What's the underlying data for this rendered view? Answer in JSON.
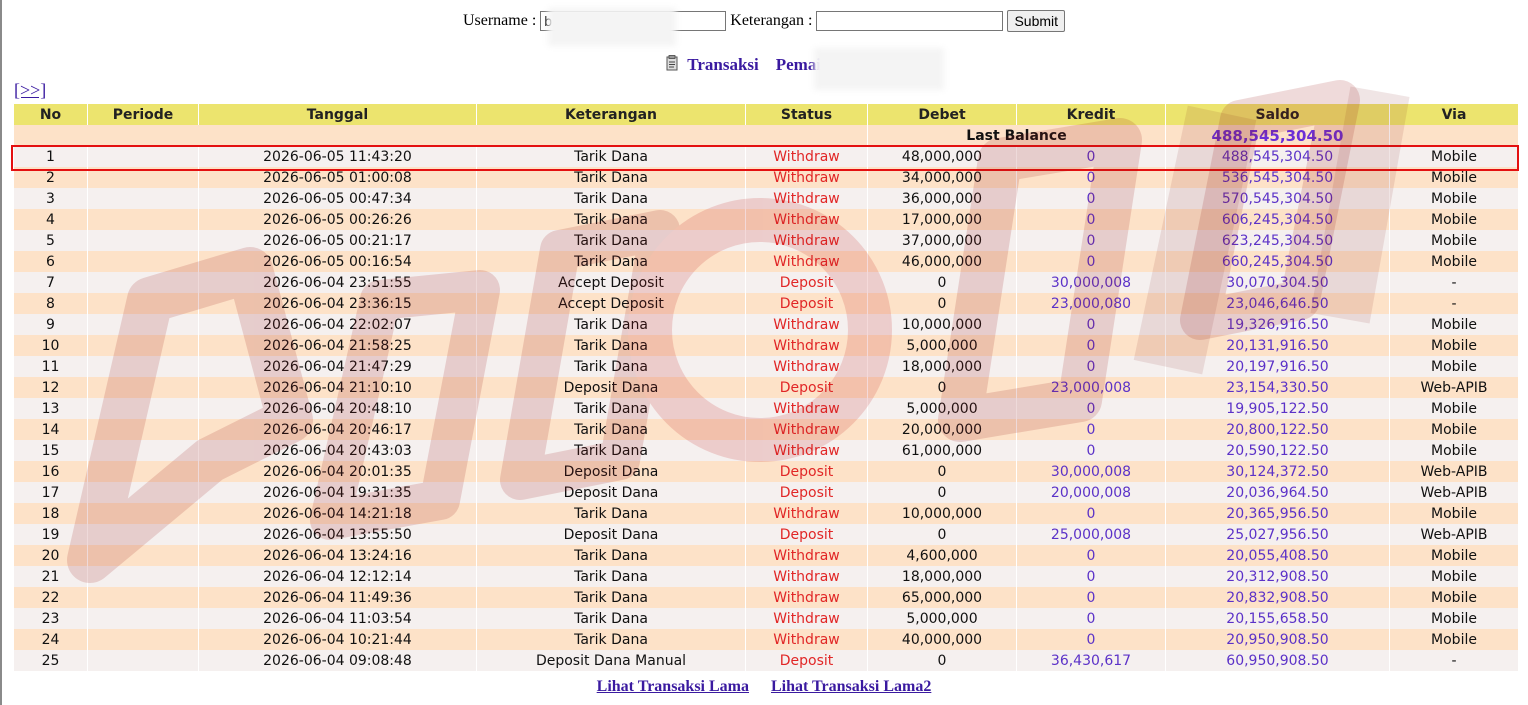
{
  "form": {
    "username_label": "Username :",
    "username_value": "b",
    "keterangan_label": "Keterangan :",
    "keterangan_value": "",
    "submit_label": "Submit"
  },
  "heading": {
    "transaksi_label": "Transaksi",
    "pemain_label": "Pemain :",
    "pemain_value": "be",
    "icon": "document-icon"
  },
  "pager": {
    "next_label": "[>>]"
  },
  "table": {
    "columns": [
      "No",
      "Periode",
      "Tanggal",
      "Keterangan",
      "Status",
      "Debet",
      "Kredit",
      "Saldo",
      "Via"
    ],
    "last_balance_label": "Last Balance",
    "last_balance_value": "488,545,304.50",
    "rows": [
      {
        "no": "1",
        "periode": "",
        "tanggal": "2026-06-05 11:43:20",
        "keterangan": "Tarik Dana",
        "status": "Withdraw",
        "debet": "48,000,000",
        "kredit": "0",
        "saldo": "488,545,304.50",
        "via": "Mobile"
      },
      {
        "no": "2",
        "periode": "",
        "tanggal": "2026-06-05 01:00:08",
        "keterangan": "Tarik Dana",
        "status": "Withdraw",
        "debet": "34,000,000",
        "kredit": "0",
        "saldo": "536,545,304.50",
        "via": "Mobile"
      },
      {
        "no": "3",
        "periode": "",
        "tanggal": "2026-06-05 00:47:34",
        "keterangan": "Tarik Dana",
        "status": "Withdraw",
        "debet": "36,000,000",
        "kredit": "0",
        "saldo": "570,545,304.50",
        "via": "Mobile"
      },
      {
        "no": "4",
        "periode": "",
        "tanggal": "2026-06-05 00:26:26",
        "keterangan": "Tarik Dana",
        "status": "Withdraw",
        "debet": "17,000,000",
        "kredit": "0",
        "saldo": "606,245,304.50",
        "via": "Mobile"
      },
      {
        "no": "5",
        "periode": "",
        "tanggal": "2026-06-05 00:21:17",
        "keterangan": "Tarik Dana",
        "status": "Withdraw",
        "debet": "37,000,000",
        "kredit": "0",
        "saldo": "623,245,304.50",
        "via": "Mobile"
      },
      {
        "no": "6",
        "periode": "",
        "tanggal": "2026-06-05 00:16:54",
        "keterangan": "Tarik Dana",
        "status": "Withdraw",
        "debet": "46,000,000",
        "kredit": "0",
        "saldo": "660,245,304.50",
        "via": "Mobile"
      },
      {
        "no": "7",
        "periode": "",
        "tanggal": "2026-06-04 23:51:55",
        "keterangan": "Accept Deposit",
        "status": "Deposit",
        "debet": "0",
        "kredit": "30,000,008",
        "saldo": "30,070,304.50",
        "via": "-"
      },
      {
        "no": "8",
        "periode": "",
        "tanggal": "2026-06-04 23:36:15",
        "keterangan": "Accept Deposit",
        "status": "Deposit",
        "debet": "0",
        "kredit": "23,000,080",
        "saldo": "23,046,646.50",
        "via": "-"
      },
      {
        "no": "9",
        "periode": "",
        "tanggal": "2026-06-04 22:02:07",
        "keterangan": "Tarik Dana",
        "status": "Withdraw",
        "debet": "10,000,000",
        "kredit": "0",
        "saldo": "19,326,916.50",
        "via": "Mobile"
      },
      {
        "no": "10",
        "periode": "",
        "tanggal": "2026-06-04 21:58:25",
        "keterangan": "Tarik Dana",
        "status": "Withdraw",
        "debet": "5,000,000",
        "kredit": "0",
        "saldo": "20,131,916.50",
        "via": "Mobile"
      },
      {
        "no": "11",
        "periode": "",
        "tanggal": "2026-06-04 21:47:29",
        "keterangan": "Tarik Dana",
        "status": "Withdraw",
        "debet": "18,000,000",
        "kredit": "0",
        "saldo": "20,197,916.50",
        "via": "Mobile"
      },
      {
        "no": "12",
        "periode": "",
        "tanggal": "2026-06-04 21:10:10",
        "keterangan": "Deposit Dana",
        "status": "Deposit",
        "debet": "0",
        "kredit": "23,000,008",
        "saldo": "23,154,330.50",
        "via": "Web-APIB"
      },
      {
        "no": "13",
        "periode": "",
        "tanggal": "2026-06-04 20:48:10",
        "keterangan": "Tarik Dana",
        "status": "Withdraw",
        "debet": "5,000,000",
        "kredit": "0",
        "saldo": "19,905,122.50",
        "via": "Mobile"
      },
      {
        "no": "14",
        "periode": "",
        "tanggal": "2026-06-04 20:46:17",
        "keterangan": "Tarik Dana",
        "status": "Withdraw",
        "debet": "20,000,000",
        "kredit": "0",
        "saldo": "20,800,122.50",
        "via": "Mobile"
      },
      {
        "no": "15",
        "periode": "",
        "tanggal": "2026-06-04 20:43:03",
        "keterangan": "Tarik Dana",
        "status": "Withdraw",
        "debet": "61,000,000",
        "kredit": "0",
        "saldo": "20,590,122.50",
        "via": "Mobile"
      },
      {
        "no": "16",
        "periode": "",
        "tanggal": "2026-06-04 20:01:35",
        "keterangan": "Deposit Dana",
        "status": "Deposit",
        "debet": "0",
        "kredit": "30,000,008",
        "saldo": "30,124,372.50",
        "via": "Web-APIB"
      },
      {
        "no": "17",
        "periode": "",
        "tanggal": "2026-06-04 19:31:35",
        "keterangan": "Deposit Dana",
        "status": "Deposit",
        "debet": "0",
        "kredit": "20,000,008",
        "saldo": "20,036,964.50",
        "via": "Web-APIB"
      },
      {
        "no": "18",
        "periode": "",
        "tanggal": "2026-06-04 14:21:18",
        "keterangan": "Tarik Dana",
        "status": "Withdraw",
        "debet": "10,000,000",
        "kredit": "0",
        "saldo": "20,365,956.50",
        "via": "Mobile"
      },
      {
        "no": "19",
        "periode": "",
        "tanggal": "2026-06-04 13:55:50",
        "keterangan": "Deposit Dana",
        "status": "Deposit",
        "debet": "0",
        "kredit": "25,000,008",
        "saldo": "25,027,956.50",
        "via": "Web-APIB"
      },
      {
        "no": "20",
        "periode": "",
        "tanggal": "2026-06-04 13:24:16",
        "keterangan": "Tarik Dana",
        "status": "Withdraw",
        "debet": "4,600,000",
        "kredit": "0",
        "saldo": "20,055,408.50",
        "via": "Mobile"
      },
      {
        "no": "21",
        "periode": "",
        "tanggal": "2026-06-04 12:12:14",
        "keterangan": "Tarik Dana",
        "status": "Withdraw",
        "debet": "18,000,000",
        "kredit": "0",
        "saldo": "20,312,908.50",
        "via": "Mobile"
      },
      {
        "no": "22",
        "periode": "",
        "tanggal": "2026-06-04 11:49:36",
        "keterangan": "Tarik Dana",
        "status": "Withdraw",
        "debet": "65,000,000",
        "kredit": "0",
        "saldo": "20,832,908.50",
        "via": "Mobile"
      },
      {
        "no": "23",
        "periode": "",
        "tanggal": "2026-06-04 11:03:54",
        "keterangan": "Tarik Dana",
        "status": "Withdraw",
        "debet": "5,000,000",
        "kredit": "0",
        "saldo": "20,155,658.50",
        "via": "Mobile"
      },
      {
        "no": "24",
        "periode": "",
        "tanggal": "2026-06-04 10:21:44",
        "keterangan": "Tarik Dana",
        "status": "Withdraw",
        "debet": "40,000,000",
        "kredit": "0",
        "saldo": "20,950,908.50",
        "via": "Mobile"
      },
      {
        "no": "25",
        "periode": "",
        "tanggal": "2026-06-04 09:08:48",
        "keterangan": "Deposit Dana Manual",
        "status": "Deposit",
        "debet": "0",
        "kredit": "36,430,617",
        "saldo": "60,950,908.50",
        "via": "-"
      }
    ]
  },
  "footer": {
    "link1": "Lihat Transaksi Lama",
    "link2": "Lihat Transaksi Lama2"
  },
  "colors": {
    "header_bg": "#ece46e",
    "row_odd": "#f5f0ef",
    "row_even": "#fde2c8",
    "status_red": "#e12626",
    "amount_purple": "#5b32c8",
    "link_purple": "#3a1aa0",
    "highlight_red": "#e41010"
  },
  "watermark_text": "BOLASITUS"
}
